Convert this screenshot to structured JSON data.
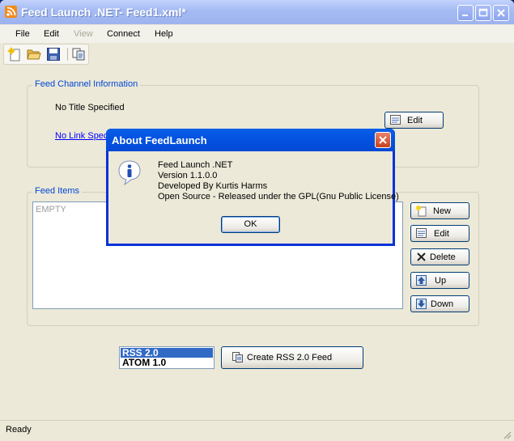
{
  "window": {
    "title": "Feed Launch .NET- Feed1.xml*"
  },
  "menu": {
    "items": [
      {
        "label": "File",
        "enabled": true
      },
      {
        "label": "Edit",
        "enabled": true
      },
      {
        "label": "View",
        "enabled": false
      },
      {
        "label": "Connect",
        "enabled": true
      },
      {
        "label": "Help",
        "enabled": true
      }
    ]
  },
  "toolbar": {
    "buttons": [
      "new-file-icon",
      "open-folder-icon",
      "save-icon",
      "publish-icon"
    ]
  },
  "channel": {
    "group_title": "Feed Channel Information",
    "title_text": "No Title Specified",
    "link_text": "No Link Spec",
    "edit_label": "Edit"
  },
  "items": {
    "group_title": "Feed Items",
    "empty_text": "EMPTY",
    "buttons": {
      "new": "New",
      "edit": "Edit",
      "delete": "Delete",
      "up": "Up",
      "down": "Down"
    }
  },
  "format": {
    "options": [
      "RSS 2.0",
      "ATOM 1.0"
    ],
    "selected": "RSS 2.0",
    "create_label": "Create RSS 2.0 Feed"
  },
  "status": {
    "text": "Ready"
  },
  "about_dialog": {
    "title": "About FeedLaunch",
    "lines": [
      "Feed Launch .NET",
      "Version 1.1.0.0",
      "Developed By Kurtis Harms",
      "Open Source - Released under the GPL(Gnu Public License)"
    ],
    "ok_label": "OK"
  },
  "colors": {
    "accent": "#0046d5",
    "selection": "#316ac5",
    "dialog_title": "#0453e2"
  }
}
